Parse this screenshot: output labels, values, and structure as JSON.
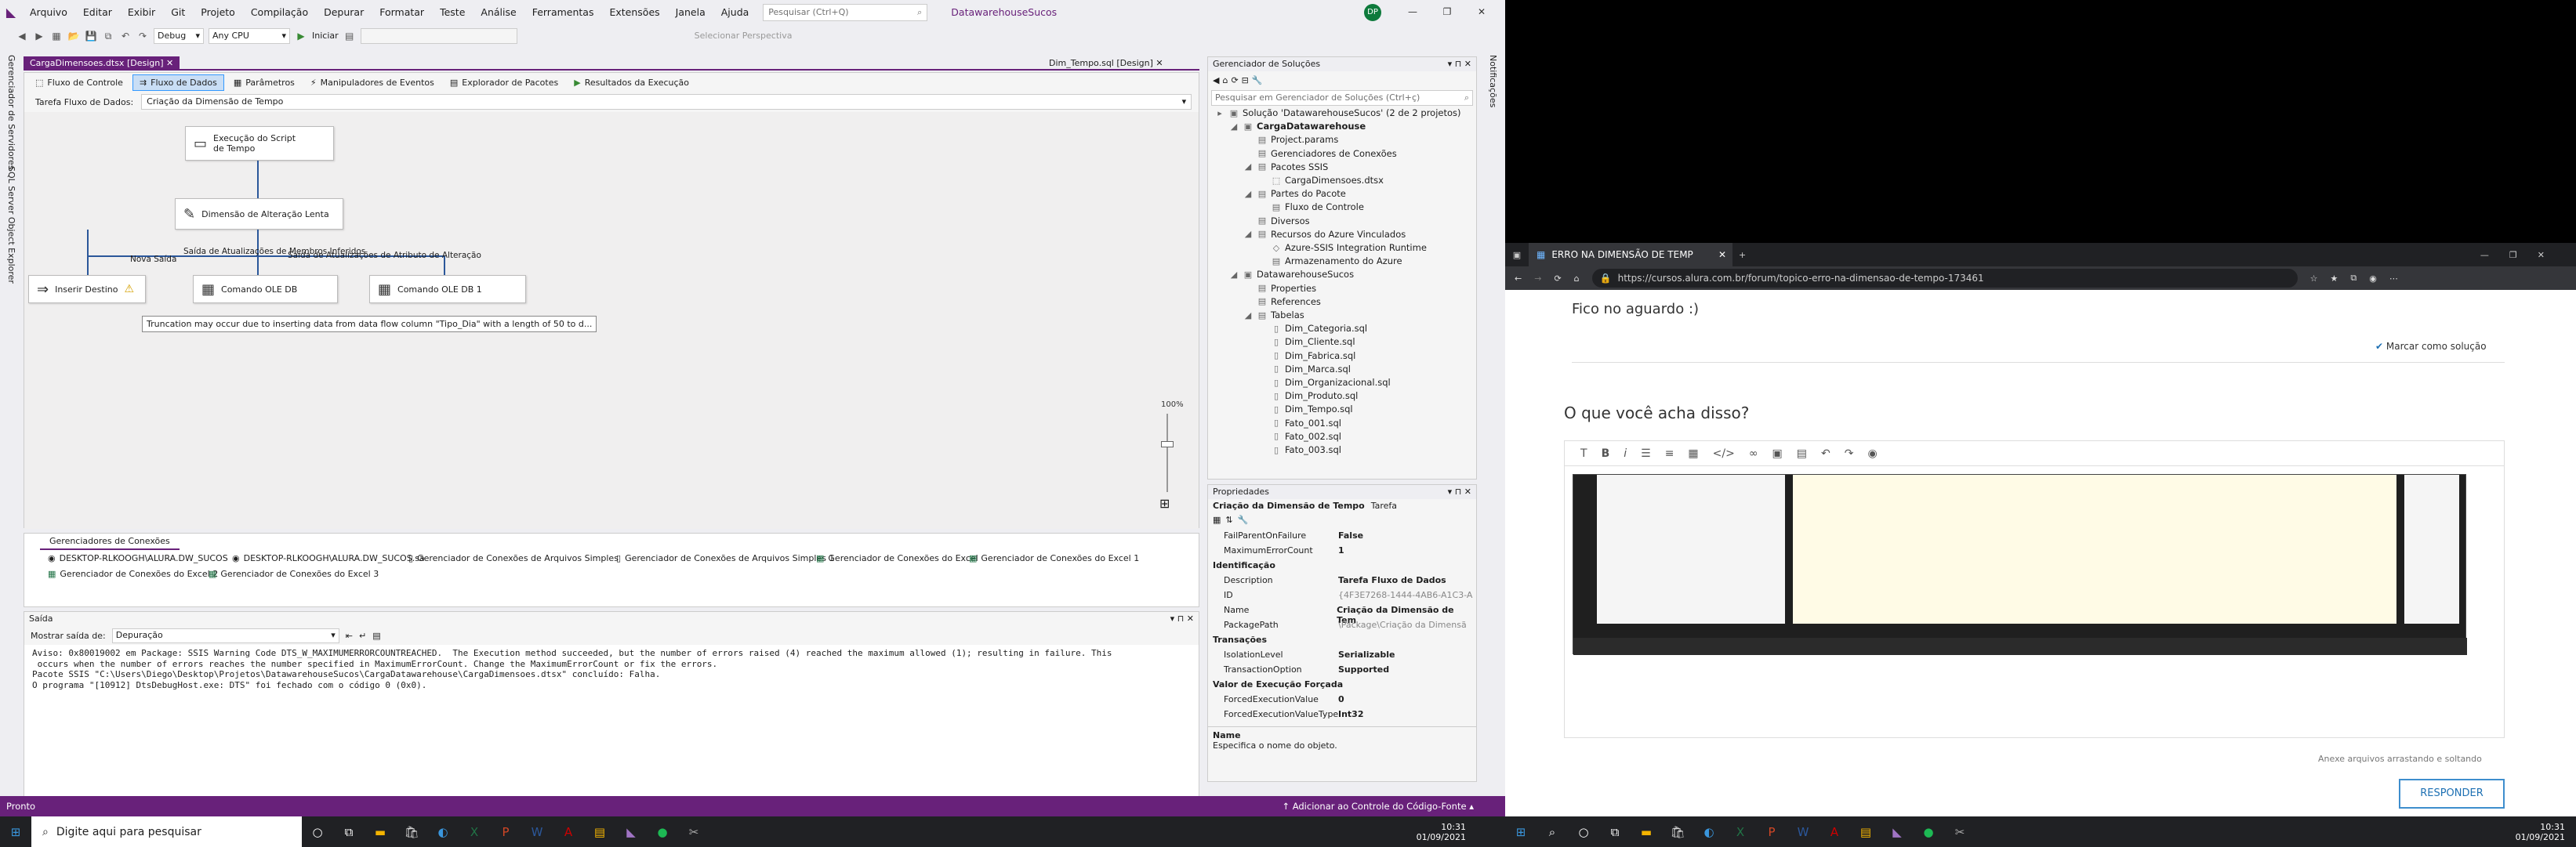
{
  "vs": {
    "menu": [
      "Arquivo",
      "Editar",
      "Exibir",
      "Git",
      "Projeto",
      "Compilação",
      "Depurar",
      "Formatar",
      "Teste",
      "Análise",
      "Ferramentas",
      "Extensões",
      "Janela",
      "Ajuda"
    ],
    "search_placeholder": "Pesquisar (Ctrl+Q)",
    "solution_name": "DatawarehouseSucos",
    "avatar": "DP",
    "toolbar": {
      "config": "Debug",
      "platform": "Any CPU",
      "start": "Iniciar",
      "perspective": "Selecionar Perspectiva"
    },
    "left_strip": [
      "Gerenciador de Servidores",
      "SQL Server Object Explorer"
    ],
    "right_strip": "Notificações",
    "doc_tabs": {
      "active": "CargaDimensoes.dtsx [Design]",
      "other": "Dim_Tempo.sql [Design]"
    },
    "designer_tabs": [
      "Fluxo de Controle",
      "Fluxo de Dados",
      "Parâmetros",
      "Manipuladores de Eventos",
      "Explorador de Pacotes",
      "Resultados da Execução"
    ],
    "task_label": "Tarefa Fluxo de Dados:",
    "task_value": "Criação da Dimensão de Tempo",
    "nodes": {
      "script": "Execução do Script de Tempo",
      "scd": "Dimensão de Alteração Lenta",
      "insert": "Inserir Destino",
      "ole1": "Comando OLE DB",
      "ole2": "Comando OLE DB 1"
    },
    "labels": {
      "nova": "Nova Saída",
      "membros": "Saída de Atualizações de Membros Inferidos",
      "atributo": "Saída de Atualizações de Atributo de Alteração"
    },
    "tooltip": "Truncation may occur due to inserting data from data flow column \"Tipo_Dia\" with a length of 50 to d...",
    "zoom": "100%",
    "cm_tab": "Gerenciadores de Conexões",
    "cm_items": [
      "DESKTOP-RLKOOGH\\ALURA.DW_SUCOS",
      "DESKTOP-RLKOOGH\\ALURA.DW_SUCOS.sa",
      "Gerenciador de Conexões de Arquivos Simples",
      "Gerenciador de Conexões de Arquivos Simples 1",
      "Gerenciador de Conexões do Excel",
      "Gerenciador de Conexões do Excel 1",
      "Gerenciador de Conexões do Excel 2",
      "Gerenciador de Conexões do Excel 3"
    ],
    "output": {
      "title": "Saída",
      "show_label": "Mostrar saída de:",
      "show_value": "Depuração",
      "lines": [
        "Aviso: 0x80019002 em Package: SSIS Warning Code DTS_W_MAXIMUMERRORCOUNTREACHED.  The Execution method succeeded, but the number of errors raised (4) reached the maximum allowed (1); resulting in failure. This",
        " occurs when the number of errors reaches the number specified in MaximumErrorCount. Change the MaximumErrorCount or fix the errors.",
        "Pacote SSIS \"C:\\Users\\Diego\\Desktop\\Projetos\\DatawarehouseSucos\\CargaDatawarehouse\\CargaDimensoes.dtsx\" concluído: Falha.",
        "O programa \"[10912] DtsDebugHost.exe: DTS\" foi fechado com o código 0 (0x0)."
      ]
    },
    "sol": {
      "title": "Gerenciador de Soluções",
      "search": "Pesquisar em Gerenciador de Soluções (Ctrl+ç)",
      "items": [
        "Solução 'DatawarehouseSucos' (2 de 2 projetos)",
        "CargaDatawarehouse",
        "Project.params",
        "Gerenciadores de Conexões",
        "Pacotes SSIS",
        "CargaDimensoes.dtsx",
        "Partes do Pacote",
        "Fluxo de Controle",
        "Diversos",
        "Recursos do Azure Vinculados",
        "Azure-SSIS Integration Runtime",
        "Armazenamento do Azure",
        "DatawarehouseSucos",
        "Properties",
        "References",
        "Tabelas",
        "Dim_Categoria.sql",
        "Dim_Cliente.sql",
        "Dim_Fabrica.sql",
        "Dim_Marca.sql",
        "Dim_Organizacional.sql",
        "Dim_Produto.sql",
        "Dim_Tempo.sql",
        "Fato_001.sql",
        "Fato_002.sql",
        "Fato_003.sql"
      ]
    },
    "props": {
      "title": "Propriedades",
      "object": "Criação da Dimensão de Tempo",
      "type": "Tarefa",
      "rows": [
        {
          "k": "FailParentOnFailure",
          "v": "False"
        },
        {
          "k": "MaximumErrorCount",
          "v": "1"
        },
        {
          "cat": "Identificação"
        },
        {
          "k": "Description",
          "v": "Tarefa Fluxo de Dados"
        },
        {
          "k": "ID",
          "v": "{4F3E7268-1444-4AB6-A1C3-A"
        },
        {
          "k": "Name",
          "v": "Criação da Dimensão de Tem"
        },
        {
          "k": "PackagePath",
          "v": "\\Package\\Criação da Dimensã"
        },
        {
          "cat": "Transações"
        },
        {
          "k": "IsolationLevel",
          "v": "Serializable"
        },
        {
          "k": "TransactionOption",
          "v": "Supported"
        },
        {
          "cat": "Valor de Execução Forçada"
        },
        {
          "k": "ForcedExecutionValue",
          "v": "0"
        },
        {
          "k": "ForcedExecutionValueType",
          "v": "Int32"
        }
      ],
      "desc_title": "Name",
      "desc_text": "Especifica o nome do objeto."
    },
    "status": {
      "left": "Pronto",
      "right": "Adicionar ao Controle do Código-Fonte"
    }
  },
  "taskbar_left": {
    "search": "Digite aqui para pesquisar",
    "time": "10:31",
    "date": "01/09/2021"
  },
  "browser": {
    "tab": "ERRO NA DIMENSÃO DE TEMP",
    "url": "https://cursos.alura.com.br/forum/topico-erro-na-dimensao-de-tempo-173461",
    "aguardo": "Fico no aguardo :)",
    "marcar": "Marcar como solução",
    "heading": "O que você acha disso?",
    "anexe": "Anexe arquivos arrastando e soltando",
    "responder": "RESPONDER"
  },
  "taskbar_right": {
    "time": "10:31",
    "date": "01/09/2021"
  }
}
